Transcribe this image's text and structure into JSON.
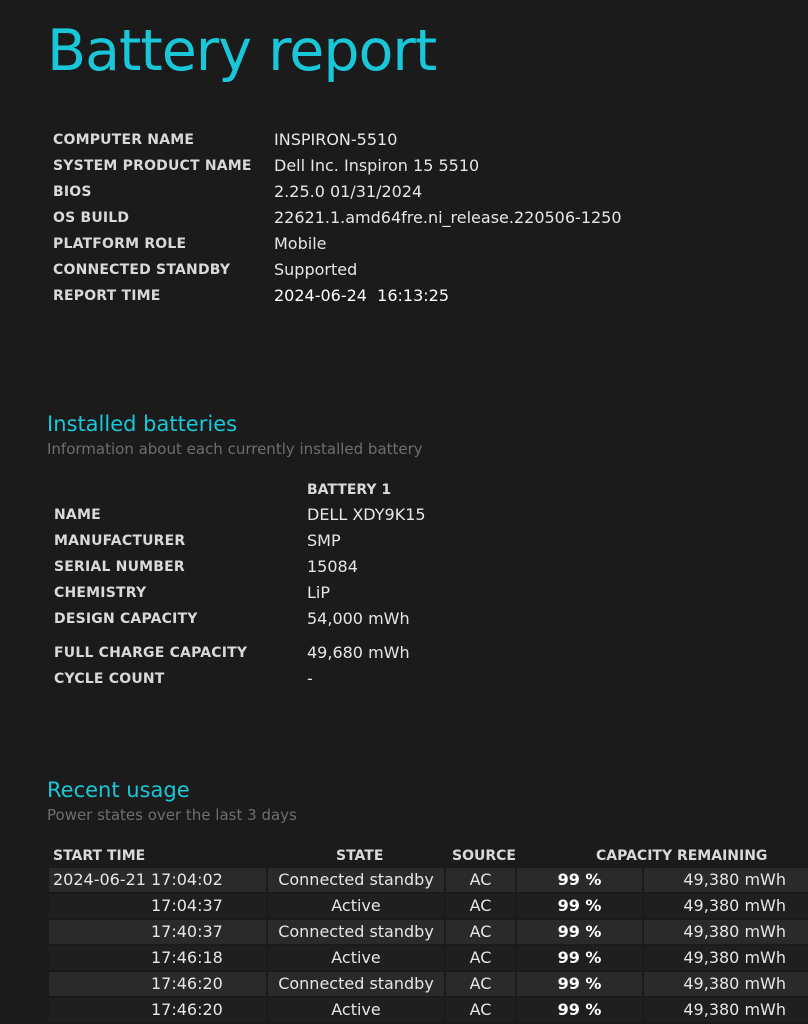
{
  "title": "Battery report",
  "system": [
    {
      "label": "COMPUTER NAME",
      "value": "INSPIRON-5510"
    },
    {
      "label": "SYSTEM PRODUCT NAME",
      "value": "Dell Inc. Inspiron 15 5510"
    },
    {
      "label": "BIOS",
      "value": "2.25.0 01/31/2024"
    },
    {
      "label": "OS BUILD",
      "value": "22621.1.amd64fre.ni_release.220506-1250"
    },
    {
      "label": "PLATFORM ROLE",
      "value": "Mobile"
    },
    {
      "label": "CONNECTED STANDBY",
      "value": "Supported"
    },
    {
      "label": "REPORT TIME",
      "value": "2024-06-24  16:13:25"
    }
  ],
  "installed": {
    "title": "Installed batteries",
    "subtitle": "Information about each currently installed battery",
    "column": "BATTERY 1",
    "rows": [
      {
        "label": "NAME",
        "value": "DELL XDY9K15"
      },
      {
        "label": "MANUFACTURER",
        "value": "SMP"
      },
      {
        "label": "SERIAL NUMBER",
        "value": "15084"
      },
      {
        "label": "CHEMISTRY",
        "value": "LiP"
      },
      {
        "label": "DESIGN CAPACITY",
        "value": "54,000 mWh"
      },
      {
        "label": "FULL CHARGE CAPACITY",
        "value": "49,680 mWh"
      },
      {
        "label": "CYCLE COUNT",
        "value": "-"
      }
    ]
  },
  "recent": {
    "title": "Recent usage",
    "subtitle": "Power states over the last 3 days",
    "headers": {
      "start_time": "START TIME",
      "state": "STATE",
      "source": "SOURCE",
      "capacity": "CAPACITY REMAINING"
    },
    "rows": [
      {
        "date": "2024-06-21",
        "time": "17:04:02",
        "state": "Connected standby",
        "source": "AC",
        "pct": "99 %",
        "mwh": "49,380 mWh"
      },
      {
        "date": "",
        "time": "17:04:37",
        "state": "Active",
        "source": "AC",
        "pct": "99 %",
        "mwh": "49,380 mWh"
      },
      {
        "date": "",
        "time": "17:40:37",
        "state": "Connected standby",
        "source": "AC",
        "pct": "99 %",
        "mwh": "49,380 mWh"
      },
      {
        "date": "",
        "time": "17:46:18",
        "state": "Active",
        "source": "AC",
        "pct": "99 %",
        "mwh": "49,380 mWh"
      },
      {
        "date": "",
        "time": "17:46:20",
        "state": "Connected standby",
        "source": "AC",
        "pct": "99 %",
        "mwh": "49,380 mWh"
      },
      {
        "date": "",
        "time": "17:46:20",
        "state": "Active",
        "source": "AC",
        "pct": "99 %",
        "mwh": "49,380 mWh"
      }
    ]
  }
}
